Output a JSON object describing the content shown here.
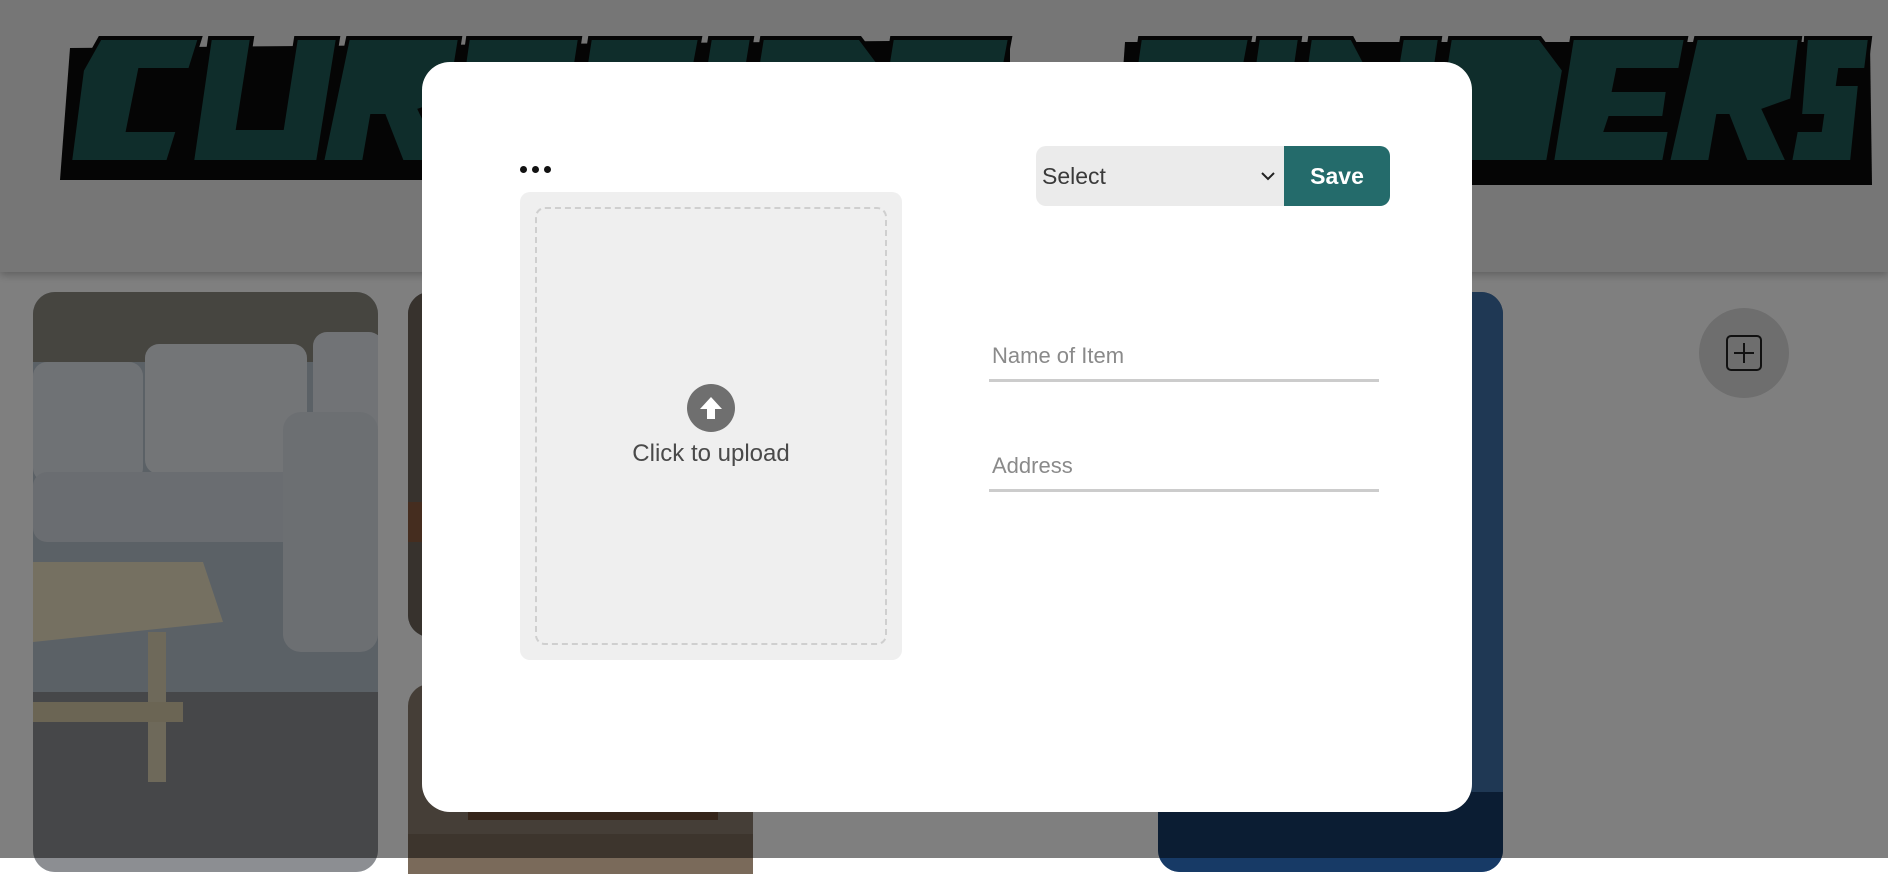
{
  "header": {
    "logo_text": "CURBSIDE FINDERS",
    "logo_color": "#1f5a56"
  },
  "gallery": {
    "items": [
      {
        "icon": "sofa-photo"
      },
      {
        "icon": "outdoor-photo"
      },
      {
        "icon": "wood-pallet-photo"
      },
      {
        "icon": "blue-appliance-photo"
      }
    ]
  },
  "fab": {
    "icon": "plus-square-icon"
  },
  "modal": {
    "menu_icon": "more-dots-icon",
    "upload": {
      "icon": "arrow-up-circle-icon",
      "label": "Click to upload"
    },
    "category_select": {
      "selected": "Select",
      "icon": "chevron-down-icon"
    },
    "save_label": "Save",
    "name_field": {
      "value": "",
      "placeholder": "Name of Item"
    },
    "address_field": {
      "value": "",
      "placeholder": "Address"
    }
  },
  "colors": {
    "accent": "#246b6b",
    "overlay": "rgba(0,0,0,0.5)",
    "panel": "#efefef"
  }
}
